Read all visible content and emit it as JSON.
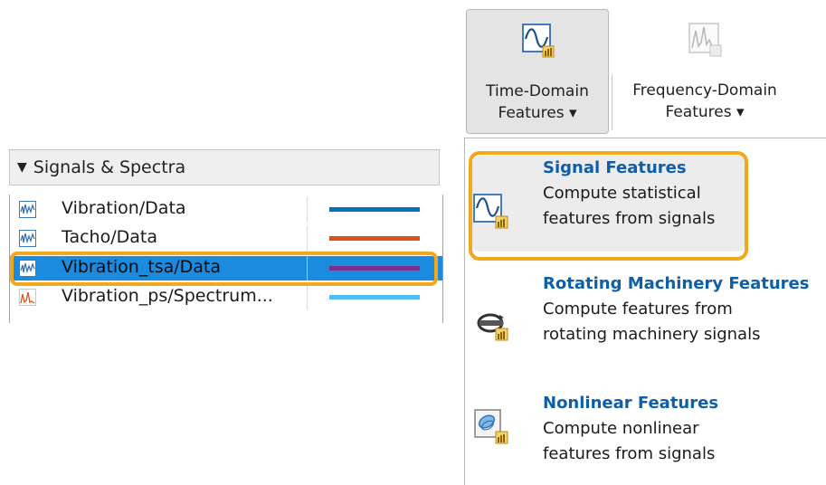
{
  "signals_panel": {
    "header": "Signals & Spectra",
    "rows": [
      {
        "name": "Vibration/Data",
        "icon": "signal-icon",
        "color": "#0072bd",
        "selected": false
      },
      {
        "name": "Tacho/Data",
        "icon": "signal-icon",
        "color": "#d95319",
        "selected": false
      },
      {
        "name": "Vibration_tsa/Data",
        "icon": "signal-icon",
        "color": "#7e2f8e",
        "selected": true
      },
      {
        "name": "Vibration_ps/Spectrum...",
        "icon": "spectrum-icon",
        "color": "#4dbeee",
        "selected": false
      }
    ]
  },
  "toolstrip": {
    "time_domain": {
      "line1": "Time-Domain",
      "line2": "Features ▾"
    },
    "frequency_domain": {
      "line1": "Frequency-Domain",
      "line2": "Features ▾"
    }
  },
  "menu": {
    "items": [
      {
        "title": "Signal Features",
        "desc1": "Compute statistical",
        "desc2": "features from signals"
      },
      {
        "title": "Rotating Machinery Features",
        "desc1": "Compute features from",
        "desc2": "rotating machinery signals"
      },
      {
        "title": "Nonlinear Features",
        "desc1": "Compute nonlinear",
        "desc2": "features from signals"
      }
    ]
  },
  "colors": {
    "highlight": "#f2a81c",
    "selection": "#1b8be0",
    "menu_title": "#0e5fa8"
  }
}
